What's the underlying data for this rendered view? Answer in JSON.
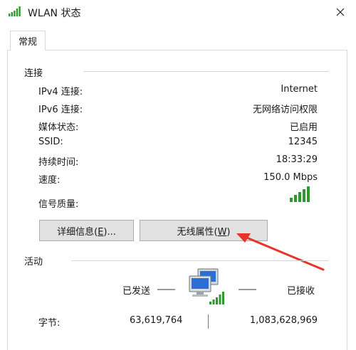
{
  "window": {
    "title": "WLAN 状态"
  },
  "tabs": [
    {
      "label": "常规"
    }
  ],
  "connection": {
    "section_label": "连接",
    "rows": [
      {
        "label": "IPv4 连接:",
        "value": "Internet"
      },
      {
        "label": "IPv6 连接:",
        "value": "无网络访问权限"
      },
      {
        "label": "媒体状态:",
        "value": "已启用"
      },
      {
        "label": "SSID:",
        "value": "12345"
      },
      {
        "label": "持续时间:",
        "value": "18:33:29"
      },
      {
        "label": "速度:",
        "value": "150.0 Mbps"
      }
    ],
    "signal_label": "信号质量:",
    "signal_bars": 5,
    "signal_color": "#2e9a2e"
  },
  "buttons": {
    "details_label": "详细信息(",
    "details_mnemonic": "E",
    "details_suffix": ")...",
    "wireless_label": "无线属性(",
    "wireless_mnemonic": "W",
    "wireless_suffix": ")"
  },
  "activity": {
    "section_label": "活动",
    "sent_label": "已发送",
    "received_label": "已接收",
    "bytes_label": "字节:",
    "bytes_sent": "63,619,764",
    "bytes_received": "1,083,628,969"
  },
  "colors": {
    "annotation_arrow": "#e8342a",
    "button_bg": "#e1e1e1",
    "monitor_blue": "#2b6fd6"
  },
  "icons": [
    "wifi-signal-icon",
    "close-icon",
    "network-computers-icon",
    "signal-strength-icon"
  ]
}
